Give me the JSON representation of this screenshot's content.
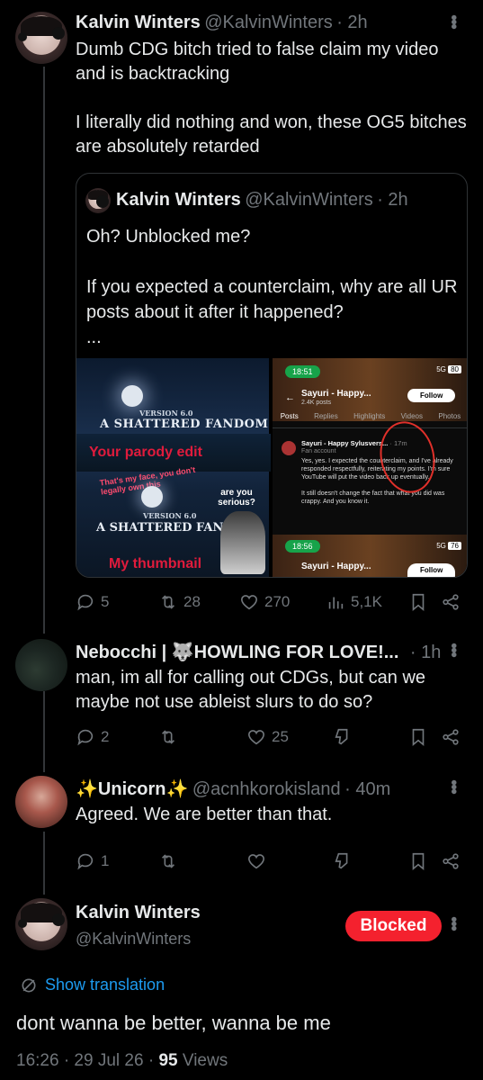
{
  "post1": {
    "name": "Kalvin Winters",
    "handle": "@KalvinWinters",
    "time": "· 2h",
    "text": "Dumb CDG bitch tried to false claim my video and is backtracking\n\nI literally did nothing and won, these OG5 bitches are absolutely retarded",
    "quote": {
      "name": "Kalvin Winters",
      "handle": "@KalvinWinters",
      "time": "· 2h",
      "text": "Oh? Unblocked me?\n\nIf you expected a counterclaim, why are all UR posts about it after it happened?\n...",
      "media_left": {
        "version_top": "VERSION 6.0",
        "title_top": "A SHATTERED FANDOM",
        "caption_top": "Your parody edit",
        "callout": "That's my face, you don't legally own this",
        "areyou": "are you serious?",
        "version_bottom": "VERSION 6.0",
        "title_bottom": "A SHATTERED FANDOM",
        "caption_bottom": "My thumbnail"
      },
      "media_right": {
        "clock": "18:51",
        "signal": "5G",
        "battery": "80",
        "profile_name": "Sayuri - Happy...",
        "posts_count": "2.4K posts",
        "follow": "Follow",
        "tabs": [
          "Posts",
          "Replies",
          "Highlights",
          "Videos",
          "Photos"
        ],
        "post_name": "Sayuri - Happy Sylusvers...",
        "post_time": "· 17m",
        "fan": "Fan account",
        "post_text": "Yes, yes. I expected the counterclaim, and I've already responded respectfully, reiterating my points. I'm sure YouTube will put the video back up eventually.\n\nIt still doesn't change the fact that what you did was crappy. And you know it.",
        "clock2": "18:56",
        "battery2": "76",
        "profile_name2": "Sayuri - Happy...",
        "follow2": "Follow"
      }
    },
    "stats": {
      "replies": "5",
      "reposts": "28",
      "likes": "270",
      "views": "5,1K"
    }
  },
  "post2": {
    "name": "Nebocchi | 🐺HOWLING FOR LOVE!...",
    "time": "· 1h",
    "text": "man, im all for calling out CDGs, but can we maybe not use ableist slurs to do so?",
    "stats": {
      "replies": "2",
      "likes": "25"
    }
  },
  "post3": {
    "name": "✨Unicorn✨",
    "handle": "@acnhkorokisland",
    "time": "· 40m",
    "text": "Agreed. We are better than that.",
    "stats": {
      "replies": "1"
    }
  },
  "main": {
    "name": "Kalvin Winters",
    "handle": "@KalvinWinters",
    "blocked": "Blocked",
    "translate": "Show translation",
    "text": "dont wanna be better, wanna be me",
    "time": "16:26 · 29 Jul 26 ·",
    "views_count": "95",
    "views_label": "Views"
  },
  "colors": {
    "accent": "#1d9bf0",
    "blocked": "#f4212e",
    "muted": "#71767b",
    "text": "#e7e9ea"
  }
}
